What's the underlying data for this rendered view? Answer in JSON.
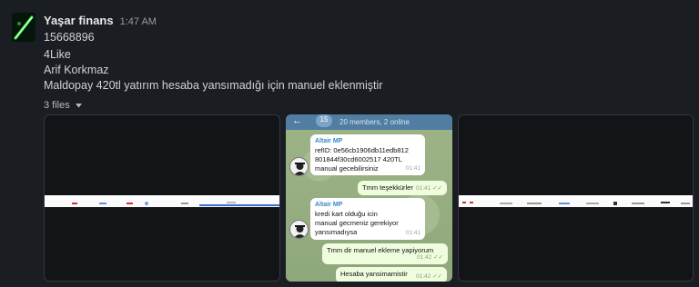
{
  "message": {
    "author": "Yaşar finans",
    "time": "1:47 AM",
    "lines": [
      "15668896",
      "4Like",
      "Arif Korkmaz",
      "Maldopay  420tl yatırım hesaba yansımadığı için manuel eklenmiştir"
    ],
    "files_label": "3 files"
  },
  "telegram": {
    "badge": "15",
    "subtitle": "20 members, 2 online",
    "messages": [
      {
        "sender": "Altair MP",
        "lines": [
          "refID: 0e56cb1906db11edb812",
          "801844f30cd6002517    420TL",
          "manual gecebilirsiniz"
        ],
        "time": "01:41"
      },
      {
        "lines": [
          "Tmm teşekkürler"
        ],
        "time": "01:41"
      },
      {
        "sender": "Altair MP",
        "lines": [
          "kredi kart olduğu icin",
          "manual gecmeniz gerekiyor",
          "yansımadıysa"
        ],
        "time": "01:41"
      },
      {
        "lines": [
          "Tmm dir manuel ekleme yapiyorum"
        ],
        "time": "01:42"
      },
      {
        "lines": [
          "Hesaba yansimamistir"
        ],
        "time": "01:42"
      }
    ]
  }
}
